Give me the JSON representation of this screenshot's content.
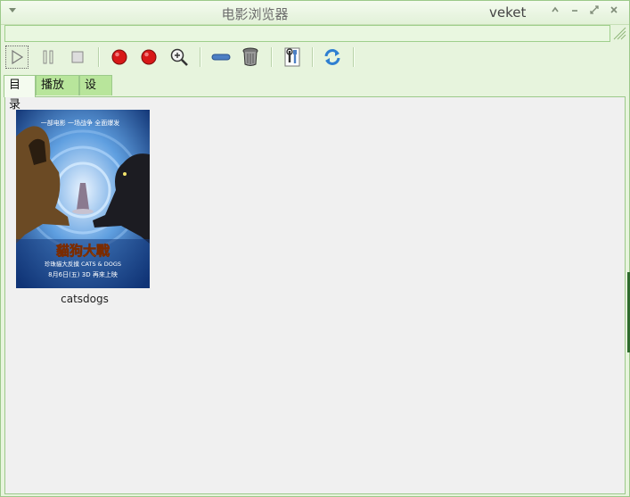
{
  "window": {
    "title": "电影浏览器",
    "app_name": "veket",
    "controls": [
      "up-icon",
      "minimize-icon",
      "maximize-icon",
      "close-icon"
    ]
  },
  "address_bar": {
    "value": ""
  },
  "toolbar": {
    "buttons": [
      {
        "name": "play-icon"
      },
      {
        "name": "pause-icon"
      },
      {
        "name": "stop-icon"
      },
      {
        "name": "record-icon"
      },
      {
        "name": "record-icon"
      },
      {
        "name": "zoom-in-icon"
      },
      {
        "name": "minus-icon"
      },
      {
        "name": "trash-icon"
      },
      {
        "name": "settings-tool-icon"
      },
      {
        "name": "refresh-icon"
      }
    ]
  },
  "tabs": [
    {
      "label": "目录",
      "active": true
    },
    {
      "label": "播放器",
      "active": false
    },
    {
      "label": "设置",
      "active": false
    }
  ],
  "catalog": {
    "items": [
      {
        "filename": "catsdogs",
        "poster": {
          "tagline": "一部电影 一场战争 全面爆发",
          "title": "貓狗大戰",
          "subtitle": "珍珠貓大反撲 CATS & DOGS",
          "release": "8月6日(五) 3D 再來上映"
        }
      }
    ]
  },
  "colors": {
    "window_bg": "#e7f4dd",
    "tab_inactive": "#b8e59b",
    "content_bg": "#f0f0f0",
    "border": "#9cc98a"
  }
}
